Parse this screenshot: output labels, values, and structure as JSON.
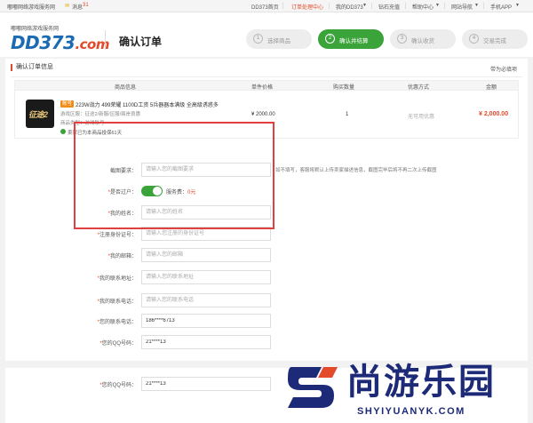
{
  "topbar": {
    "site_name": "嘟嘟网络游戏服务网",
    "messages_label": "消息",
    "messages_count": "31",
    "links": [
      "DD373首页",
      "订单处理中心",
      "我的DD373",
      "钻石充值",
      "帮助中心",
      "网站导航",
      "手机APP"
    ],
    "active_link": "订单处理中心"
  },
  "header": {
    "logo_tagline": "嘟嘟网络游戏服务网",
    "logo_main": "DD373",
    "logo_suffix": ".com",
    "page_title": "确认订单",
    "steps": [
      {
        "num": "1",
        "label": "选择商品"
      },
      {
        "num": "2",
        "label": "确认并结算"
      },
      {
        "num": "3",
        "label": "确认收货"
      },
      {
        "num": "4",
        "label": "交易完成"
      }
    ],
    "active_step": 2
  },
  "order": {
    "section_title": "确认订单信息",
    "back_link": "带为必填项",
    "columns": [
      "商品信息",
      "单件价格",
      "购买数量",
      "优惠方式",
      "金额"
    ],
    "product": {
      "thumb_text": "征途2",
      "badge": "账号",
      "title": "223W战力 499荣耀 1100D工资 5兵器器本满级 全高级诱惑多",
      "line1": "游戏区服：征途2/新服/区服/兩岸良惠",
      "line2": "商品类型：游戏账号",
      "safe_text": "卖家已为本商品投保61天",
      "price": "¥ 2000.00",
      "quantity": "1",
      "discount": "无可用优惠",
      "amount": "¥ 2,000.00"
    }
  },
  "form": {
    "screenshot": {
      "label": "截图要求：",
      "placeholder": "请输入您的截图要求",
      "hint": "如不填写，客服将默认上传卖家描述信息，截图完毕后将不再二次上传截图"
    },
    "transfer": {
      "label": "是否过户：",
      "fee_label": "服务费：",
      "fee_value": "0元"
    },
    "name": {
      "label": "我的姓名：",
      "placeholder": "请输入您的姓名"
    },
    "idcard": {
      "label": "注册身份证号：",
      "placeholder": "请输入您注册的身份证号"
    },
    "email": {
      "label": "我的邮箱：",
      "placeholder": "请输入您的邮箱"
    },
    "address": {
      "label": "我的联系地址：",
      "placeholder": "请输入您的联系地址"
    },
    "phone1": {
      "label": "我的联系电话：",
      "placeholder": "请输入您的联系电话"
    },
    "phone2": {
      "label": "您的联系电话：",
      "value": "186****6713"
    },
    "qq": {
      "label": "您的QQ号码：",
      "value": "21****13"
    },
    "qq2": {
      "label": "您的QQ号码：",
      "value": "21****13"
    }
  },
  "watermark": {
    "cn": "尚游乐园",
    "en": "SHYIYUANYK.COM"
  },
  "colors": {
    "accent": "#e24a2b",
    "brand": "#1b6ab2",
    "success": "#3aa33a",
    "highlight_box": "#e04040"
  }
}
